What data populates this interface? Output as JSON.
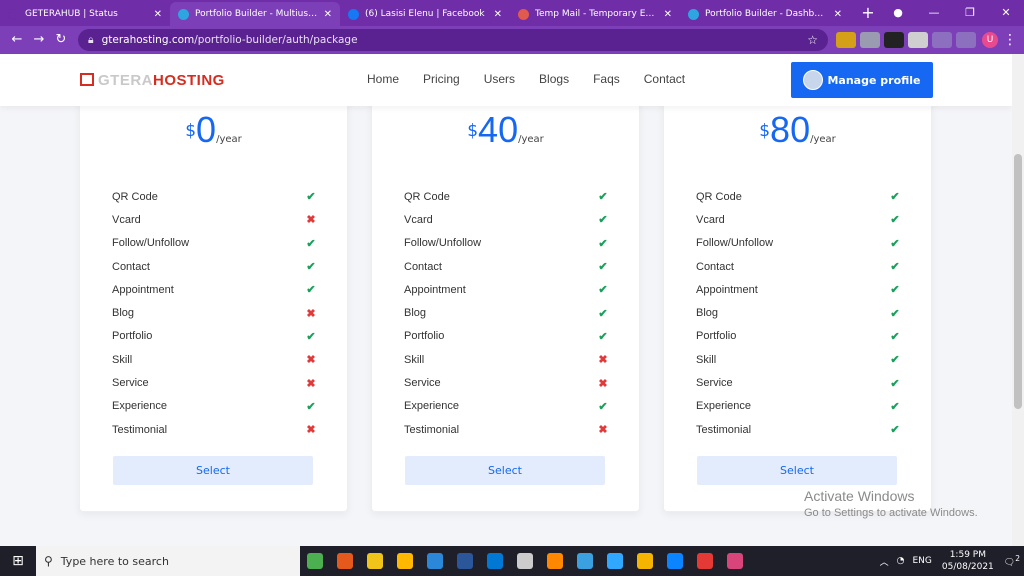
{
  "browser": {
    "tabs": [
      {
        "title": "GETERAHUB | Status",
        "color": "#6f2da8"
      },
      {
        "title": "Portfolio Builder - Multiuser re",
        "color": "#2ea5e0"
      },
      {
        "title": "(6) Lasisi Elenu | Facebook",
        "color": "#1877f2"
      },
      {
        "title": "Temp Mail - Temporary Email",
        "color": "#e05a4f"
      },
      {
        "title": "Portfolio Builder - Dashboard",
        "color": "#2ea5e0"
      }
    ],
    "close_glyph": "✕",
    "new_tab_glyph": "+",
    "url_domain": "gterahosting.com",
    "url_path": "/portfolio-builder/auth/package",
    "profile_initial": "U"
  },
  "site": {
    "logo_prefix": "GTERA",
    "logo_suffix": "HOSTING",
    "menu": [
      "Home",
      "Pricing",
      "Users",
      "Blogs",
      "Faqs",
      "Contact"
    ],
    "manage_label": "Manage profile"
  },
  "plans": [
    {
      "currency": "$",
      "amount": "0",
      "period": "/year",
      "select": "Select",
      "features": [
        {
          "name": "QR Code",
          "included": true
        },
        {
          "name": "Vcard",
          "included": false
        },
        {
          "name": "Follow/Unfollow",
          "included": true
        },
        {
          "name": "Contact",
          "included": true
        },
        {
          "name": "Appointment",
          "included": true
        },
        {
          "name": "Blog",
          "included": false
        },
        {
          "name": "Portfolio",
          "included": true
        },
        {
          "name": "Skill",
          "included": false
        },
        {
          "name": "Service",
          "included": false
        },
        {
          "name": "Experience",
          "included": true
        },
        {
          "name": "Testimonial",
          "included": false
        }
      ]
    },
    {
      "currency": "$",
      "amount": "40",
      "period": "/year",
      "select": "Select",
      "features": [
        {
          "name": "QR Code",
          "included": true
        },
        {
          "name": "Vcard",
          "included": true
        },
        {
          "name": "Follow/Unfollow",
          "included": true
        },
        {
          "name": "Contact",
          "included": true
        },
        {
          "name": "Appointment",
          "included": true
        },
        {
          "name": "Blog",
          "included": true
        },
        {
          "name": "Portfolio",
          "included": true
        },
        {
          "name": "Skill",
          "included": false
        },
        {
          "name": "Service",
          "included": false
        },
        {
          "name": "Experience",
          "included": true
        },
        {
          "name": "Testimonial",
          "included": false
        }
      ]
    },
    {
      "currency": "$",
      "amount": "80",
      "period": "/year",
      "select": "Select",
      "features": [
        {
          "name": "QR Code",
          "included": true
        },
        {
          "name": "Vcard",
          "included": true
        },
        {
          "name": "Follow/Unfollow",
          "included": true
        },
        {
          "name": "Contact",
          "included": true
        },
        {
          "name": "Appointment",
          "included": true
        },
        {
          "name": "Blog",
          "included": true
        },
        {
          "name": "Portfolio",
          "included": true
        },
        {
          "name": "Skill",
          "included": true
        },
        {
          "name": "Service",
          "included": true
        },
        {
          "name": "Experience",
          "included": true
        },
        {
          "name": "Testimonial",
          "included": true
        }
      ]
    }
  ],
  "watermark": {
    "line1": "Activate Windows",
    "line2": "Go to Settings to activate Windows."
  },
  "taskbar": {
    "search_placeholder": "Type here to search",
    "lang": "ENG",
    "time": "1:59 PM",
    "date": "05/08/2021",
    "notification_count": "2",
    "apps": [
      "#4caf50",
      "#e55a1c",
      "#f0c419",
      "#ffb900",
      "#2b88d8",
      "#2b579a",
      "#0078d4",
      "#cccccc",
      "#ff8800",
      "#3aa0e0",
      "#31a8ff",
      "#f4b400",
      "#0a84ff",
      "#e53935",
      "#d8457a"
    ]
  }
}
